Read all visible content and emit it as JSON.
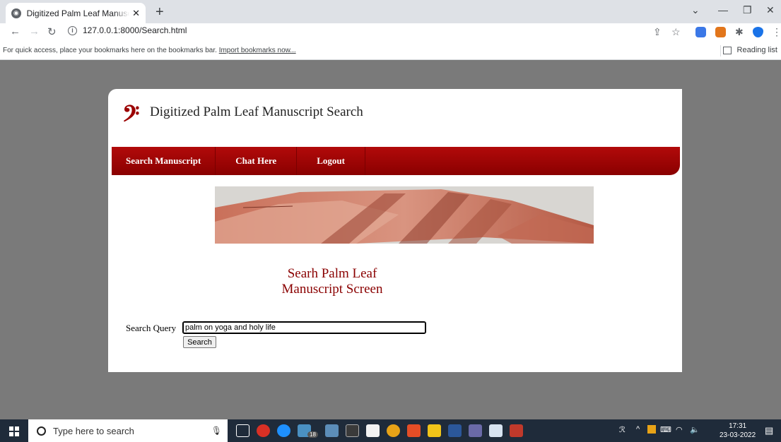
{
  "browser": {
    "tab_title": "Digitized Palm Leaf Manuscript S",
    "new_tab_glyph": "+",
    "url": "127.0.0.1:8000/Search.html",
    "bookmarks_text": "For quick access, place your bookmarks here on the bookmarks bar.",
    "bookmarks_link": "Import bookmarks now...",
    "reading_list": "Reading list"
  },
  "page": {
    "logo_glyph": "𝄢",
    "site_title": "Digitized Palm Leaf Manuscript Search",
    "nav": [
      "Search Manuscript",
      "Chat Here",
      "Logout"
    ],
    "heading_line1": "Searh Palm Leaf",
    "heading_line2": "Manuscript Screen",
    "query_label": "Search Query",
    "query_value": "palm on yoga and holy life",
    "search_button": "Search",
    "accent_color": "#9b0000"
  },
  "taskbar": {
    "search_placeholder": "Type here to search",
    "badge": "18",
    "time": "17:31",
    "date": "23-03-2022"
  }
}
